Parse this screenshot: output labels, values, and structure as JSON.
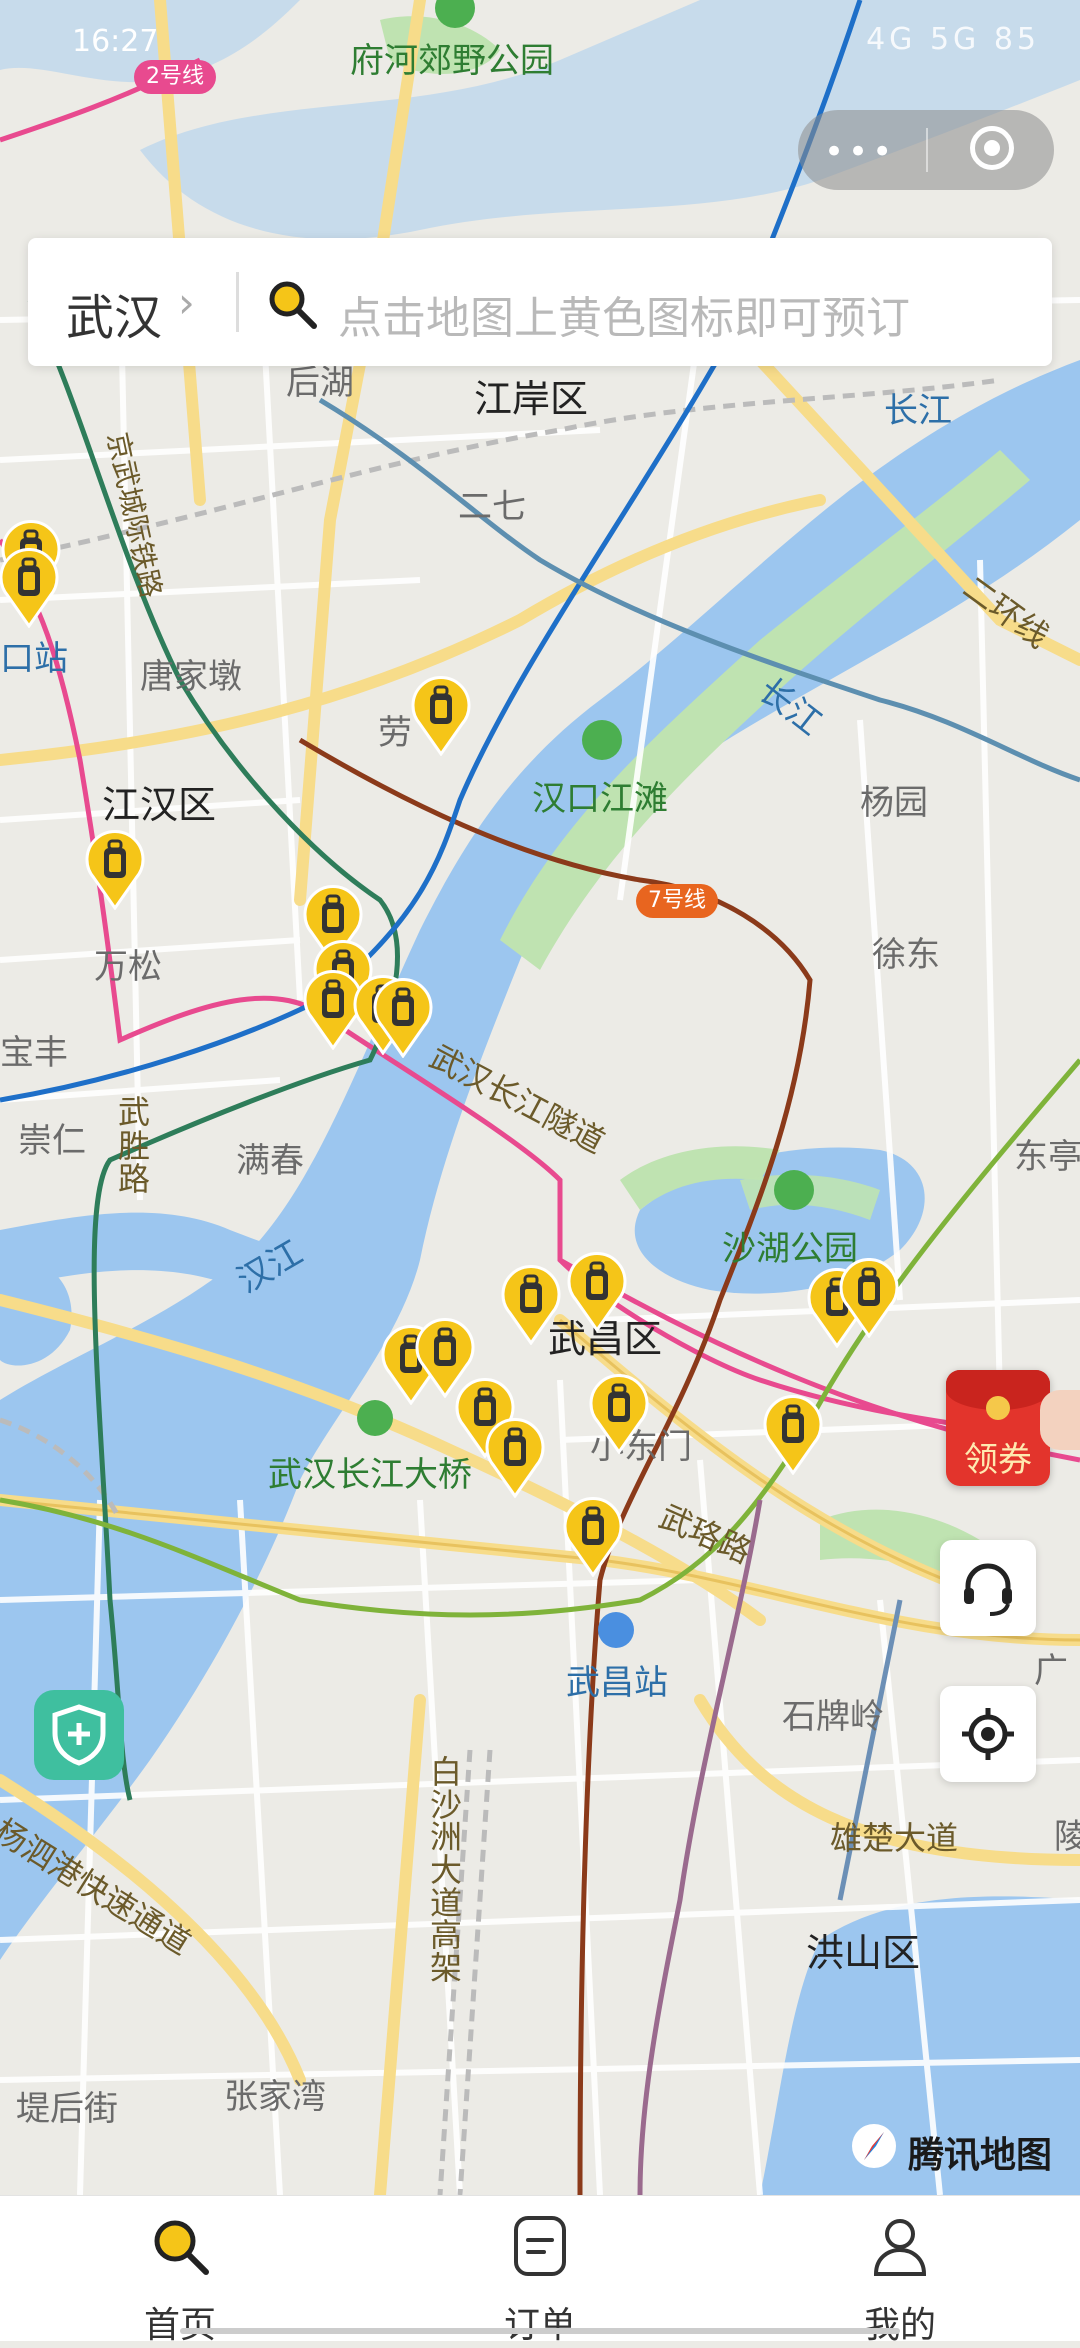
{
  "status_bar": {
    "time": "16:27",
    "right_icons": "4G 5G 85"
  },
  "search": {
    "city": "武汉",
    "chevron": "›",
    "placeholder": "点击地图上黄色图标即可预订"
  },
  "map": {
    "labels": {
      "fuhe_park": "府河郊野公园",
      "jiangan": "江岸区",
      "houhu": "后湖",
      "erqi": "二七",
      "changjiang_1": "长江",
      "changjiang_2": "长江",
      "tangjiadun": "唐家墩",
      "lao": "劳",
      "hankou_jiangtan": "汉口江滩",
      "yangyuan": "杨园",
      "jianghan": "江汉区",
      "wansong": "万松",
      "xudong": "徐东",
      "baofeng": "宝丰",
      "chongren": "崇仁",
      "wusheng_road": "武胜路",
      "manchun": "满春",
      "tunnel": "武汉长江隧道",
      "donghu": "东亭",
      "hanjiang": "汉江",
      "shahu_park": "沙湖公园",
      "wuchang": "武昌区",
      "xiaodongmen": "小东门",
      "yangtze_bridge": "武汉长江大桥",
      "wuluo_road": "武珞路",
      "wuchang_station": "武昌站",
      "shipailing": "石牌岭",
      "xiongchu": "雄楚大道",
      "baishazhou": "白沙洲大道高架",
      "hongshan": "洪山区",
      "yangsigang": "杨泗港快速通道",
      "zhangjiawan": "张家湾",
      "dihoujie": "堤后街",
      "hankou_station": "口站",
      "jingwu_rail": "京武城际铁路",
      "second_ring": "二环线",
      "guang": "广",
      "ling": "陵"
    },
    "metro_badges": [
      {
        "text": "2号线",
        "color": "#e84a8f"
      },
      {
        "text": "7号线",
        "color": "#e8651f"
      }
    ],
    "locker_pins": 20
  },
  "floating": {
    "coupon": "领券",
    "map_brand": "腾讯地图"
  },
  "tabs": [
    {
      "label": "首页",
      "icon": "search-icon"
    },
    {
      "label": "订单",
      "icon": "order-icon"
    },
    {
      "label": "我的",
      "icon": "profile-icon"
    }
  ],
  "colors": {
    "accent_yellow": "#f5c518",
    "water": "#9cc6ef",
    "park": "#bfe3b1",
    "road": "#ffffff",
    "major_road": "#f7dc8a"
  }
}
